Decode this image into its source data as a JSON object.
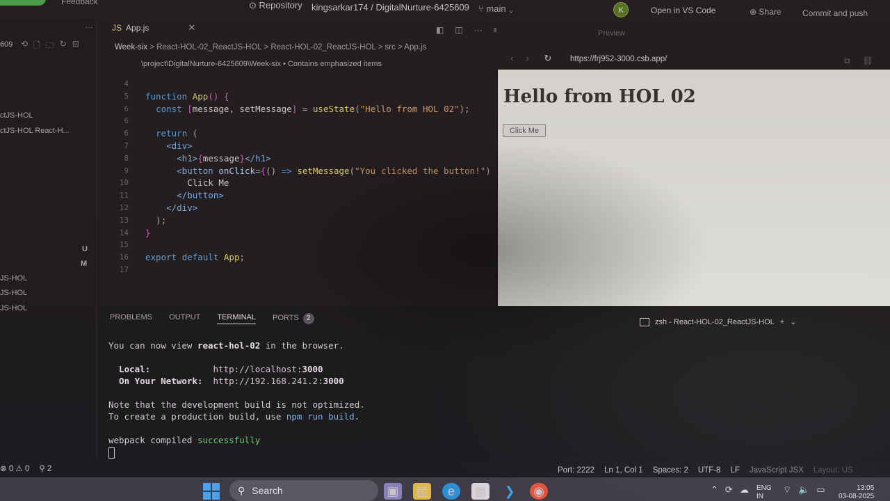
{
  "topbar": {
    "feedback": "Feedback",
    "repository": "Repository",
    "repo_path": "kingsarkar174 / DigitalNurture-6425609",
    "branch": "main",
    "avatar_letter": "K",
    "open_in_vscode": "Open in VS Code",
    "share": "Share",
    "commit_push": "Commit and push"
  },
  "explorer": {
    "folder_suffix": "609",
    "items": [
      {
        "label": "ctJS-HOL"
      },
      {
        "label": "ctJS-HOL   React-H..."
      },
      {
        "label": "JS-HOL"
      },
      {
        "label": "JS-HOL"
      },
      {
        "label": "JS-HOL"
      }
    ],
    "badge_u": "U",
    "badge_m": "M"
  },
  "editor": {
    "tab_label": "App.js",
    "breadcrumb": {
      "first": "Week-six",
      "rest": "> React-HOL-02_ReactJS-HOL > React-HOL-02_ReactJS-HOL > src > App.js"
    },
    "hint": "\\project\\DigitalNurture-6425609\\Week-six • Contains emphasized items",
    "lines": [
      {
        "n": "4",
        "html": ""
      },
      {
        "n": "5",
        "html": "<span class='kw'>function</span> <span class='fn'>App</span><span class='br'>()</span> <span class='br'>{</span>"
      },
      {
        "n": "6",
        "html": "  <span class='kw'>const</span> <span class='br'>[</span><span class='var'>message</span><span class='pun'>,</span> <span class='var'>setMessage</span><span class='br'>]</span> <span class='pun'>=</span> <span class='fn'>useState</span><span class='pun'>(</span><span class='str'>\"Hello from HOL 02\"</span><span class='pun'>);</span>"
      },
      {
        "n": "6",
        "html": ""
      },
      {
        "n": "6",
        "html": "  <span class='kw'>return</span> <span class='pun'>(</span>"
      },
      {
        "n": "7",
        "html": "    <span class='tag'>&lt;div&gt;</span>"
      },
      {
        "n": "8",
        "html": "      <span class='tag'>&lt;h1&gt;</span><span class='br'>{</span><span class='var'>message</span><span class='br'>}</span><span class='tag'>&lt;/h1&gt;</span>"
      },
      {
        "n": "9",
        "html": "      <span class='tag'>&lt;button</span> <span class='attr'>onClick</span><span class='pun'>=</span><span class='br'>{</span><span class='pun'>()</span> <span class='kw'>=&gt;</span> <span class='fn'>setMessage</span><span class='pun'>(</span><span class='str'>\"You clicked the button!\"</span><span class='pun'>)</span>"
      },
      {
        "n": "10",
        "html": "        <span class='var'>Click Me</span>"
      },
      {
        "n": "11",
        "html": "      <span class='tag'>&lt;/button&gt;</span>"
      },
      {
        "n": "12",
        "html": "    <span class='tag'>&lt;/div&gt;</span>"
      },
      {
        "n": "13",
        "html": "  <span class='pun'>);</span>"
      },
      {
        "n": "14",
        "html": "<span class='br'>}</span>"
      },
      {
        "n": "15",
        "html": ""
      },
      {
        "n": "16",
        "html": "<span class='kw'>export</span> <span class='kw'>default</span> <span class='fn'>App</span><span class='pun'>;</span>"
      },
      {
        "n": "17",
        "html": ""
      }
    ]
  },
  "preview": {
    "label": "Preview",
    "url": "https://frj952-3000.csb.app/",
    "heading": "Hello from HOL 02",
    "button": "Click Me"
  },
  "panel": {
    "tabs": [
      "PROBLEMS",
      "OUTPUT",
      "TERMINAL",
      "PORTS"
    ],
    "ports_count": "2",
    "terminal_title": "zsh - React-HOL-02_ReactJS-HOL",
    "terminal": {
      "l1_a": "You can now view ",
      "l1_b": "react-hol-02",
      "l1_c": " in the browser.",
      "local_label": "  Local:",
      "local_url_a": "http://localhost:",
      "local_url_b": "3000",
      "net_label": "  On Your Network:",
      "net_url_a": "http://192.168.241.2:",
      "net_url_b": "3000",
      "note1": "Note that the development build is not optimized.",
      "note2_a": "To create a production build, use ",
      "note2_b": "npm run build",
      "note2_c": ".",
      "compiled_a": "webpack compiled ",
      "compiled_b": "successfully"
    }
  },
  "statusbar": {
    "errors": "⊗ 0 ⚠ 0",
    "ports": "2",
    "port": "Port: 2222",
    "position": "Ln 1, Col 1",
    "spaces": "Spaces: 2",
    "encoding": "UTF-8",
    "eol": "LF",
    "language": "JavaScript JSX",
    "layout": "Layout: US"
  },
  "taskbar": {
    "search": "Search",
    "lang_top": "ENG",
    "lang_bottom": "IN",
    "time": "13:05",
    "date": "03-08-2025"
  }
}
